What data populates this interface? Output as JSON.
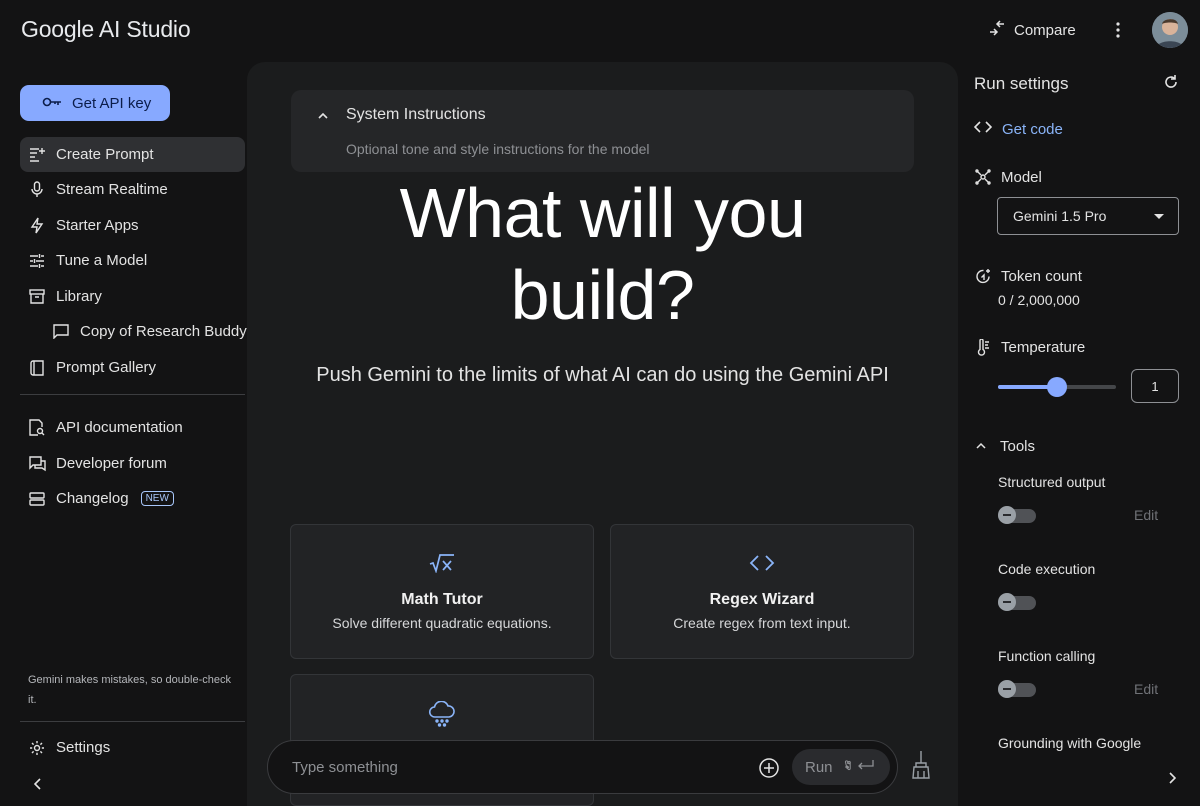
{
  "header": {
    "brand": "Google AI Studio",
    "compare_label": "Compare"
  },
  "sidebar": {
    "api_key_label": "Get API key",
    "items": [
      {
        "label": "Create Prompt",
        "icon": "create-prompt-icon"
      },
      {
        "label": "Stream Realtime",
        "icon": "mic-icon"
      },
      {
        "label": "Starter Apps",
        "icon": "bolt-icon"
      },
      {
        "label": "Tune a Model",
        "icon": "tune-icon"
      },
      {
        "label": "Library",
        "icon": "library-icon"
      },
      {
        "label": "Copy of Research Buddy",
        "icon": "chat-icon"
      },
      {
        "label": "Prompt Gallery",
        "icon": "book-icon"
      }
    ],
    "resources": [
      {
        "label": "API documentation",
        "icon": "docs-search-icon"
      },
      {
        "label": "Developer forum",
        "icon": "forum-icon"
      },
      {
        "label": "Changelog",
        "icon": "changelog-icon",
        "badge": "NEW"
      }
    ],
    "disclaimer": "Gemini makes mistakes, so double-check it.",
    "settings_label": "Settings"
  },
  "main": {
    "system_instructions": {
      "title": "System Instructions",
      "placeholder": "Optional tone and style instructions for the model"
    },
    "hero_line1": "What will you",
    "hero_line2": "build?",
    "subtitle": "Push Gemini to the limits of what AI can do using the Gemini API",
    "cards": [
      {
        "title": "Math Tutor",
        "description": "Solve different quadratic equations.",
        "icon": "square-root-icon"
      },
      {
        "title": "Regex Wizard",
        "description": "Create regex from text input.",
        "icon": "code-brackets-icon"
      },
      {
        "title": "",
        "description": "",
        "icon": "weather-snow-cloud-icon"
      }
    ],
    "input_placeholder": "Type something",
    "run_label": "Run"
  },
  "run_settings": {
    "title": "Run settings",
    "get_code_label": "Get code",
    "model_label": "Model",
    "model_value": "Gemini 1.5 Pro",
    "token_count_label": "Token count",
    "token_count_value": "0 / 2,000,000",
    "temperature_label": "Temperature",
    "temperature_value": "1",
    "temperature_fraction": 0.5,
    "tools_label": "Tools",
    "tools": [
      {
        "label": "Structured output",
        "enabled": false,
        "edit": "Edit"
      },
      {
        "label": "Code execution",
        "enabled": false,
        "edit": ""
      },
      {
        "label": "Function calling",
        "enabled": false,
        "edit": "Edit"
      },
      {
        "label": "Grounding with Google",
        "enabled": false,
        "edit": ""
      }
    ]
  },
  "colors": {
    "accent": "#87a9ff",
    "background": "#131314",
    "panel": "#1b1c1d",
    "link": "#8ab4f8"
  }
}
